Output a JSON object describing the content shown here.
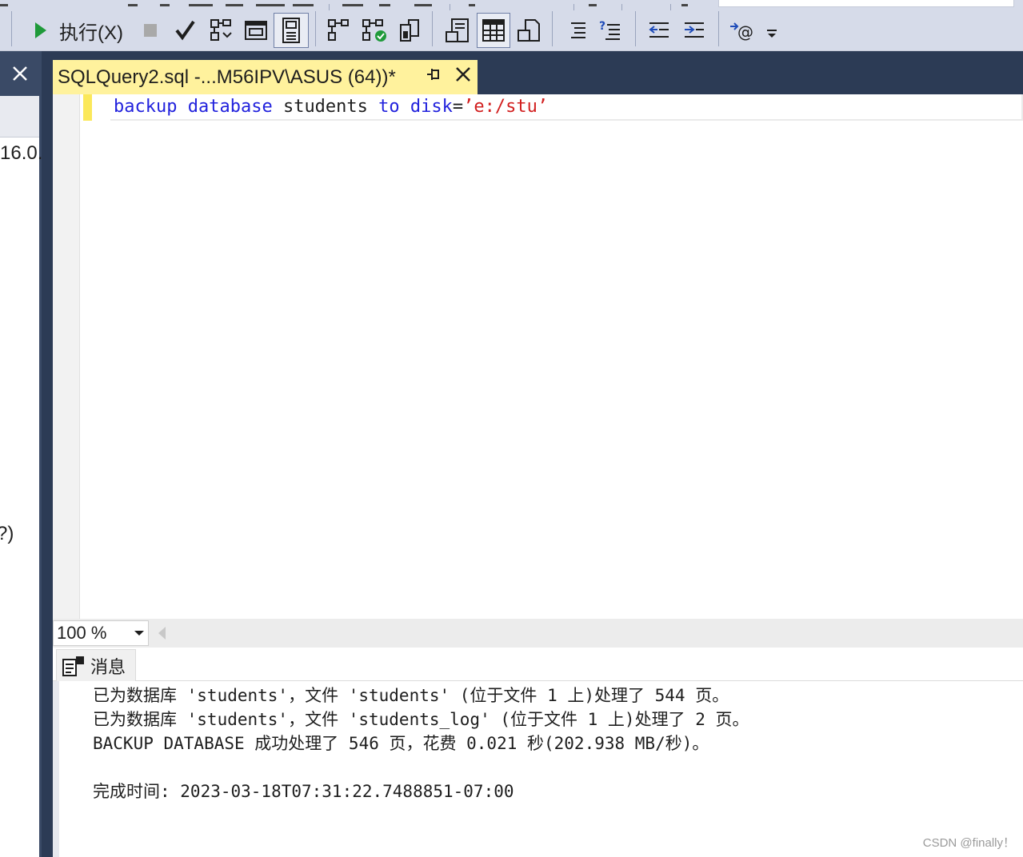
{
  "toolbar": {
    "execute_label": "执行(X)",
    "icons": [
      "execute-icon",
      "stop-icon",
      "parse-icon",
      "display-plan-icon",
      "query-options-icon",
      "results-to-text-icon",
      "include-plan-icon",
      "client-stats-icon",
      "live-stats-icon",
      "results-grid-icon",
      "results-file-icon",
      "comment-icon",
      "uncomment-icon",
      "outdent-icon",
      "indent-icon",
      "specify-values-icon",
      "overflow-icon"
    ]
  },
  "left_panel": {
    "line1": "16.0.",
    "line2": "?)"
  },
  "document": {
    "tab_title": "SQLQuery2.sql -...M56IPV\\ASUS (64))*",
    "code": {
      "kw1": "backup",
      "sp1": " ",
      "kw2": "database",
      "plain1": " students ",
      "kw3": "to",
      "sp2": " ",
      "kw4": "disk",
      "plain2": "=",
      "str1": "’e:/stu’"
    }
  },
  "zoom": {
    "value": "100 %"
  },
  "results": {
    "tab_label": "消息",
    "messages": [
      "已为数据库 'students'，文件 'students' (位于文件 1 上)处理了 544 页。",
      "已为数据库 'students'，文件 'students_log' (位于文件 1 上)处理了 2 页。",
      "BACKUP DATABASE 成功处理了 546 页，花费 0.021 秒(202.938 MB/秒)。",
      "完成时间: 2023-03-18T07:31:22.7488851-07:00"
    ]
  },
  "watermark": "CSDN @finally！",
  "colors": {
    "toolbar_bg": "#d6dbe9",
    "tab_active_bg": "#fff29d",
    "chrome_dark": "#2c3b55",
    "keyword": "#2222dd",
    "string": "#d22020",
    "execute_green": "#1f9a3a"
  }
}
